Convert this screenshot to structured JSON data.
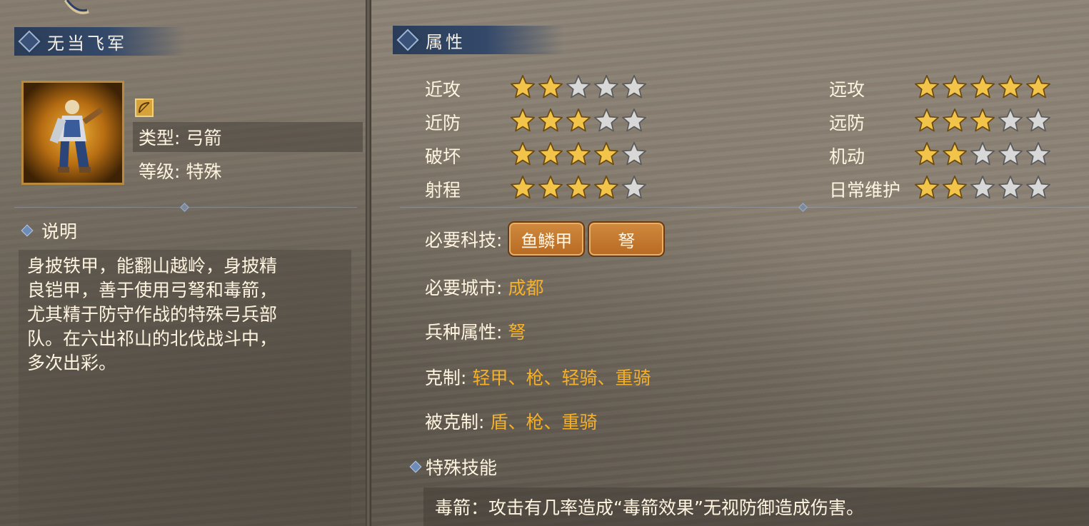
{
  "unit": {
    "name": "无当飞军",
    "type_text": "类型: 弓箭",
    "level_text": "等级: 特殊"
  },
  "description": {
    "header": "说明",
    "lines": [
      "身披铁甲，能翻山越岭，身披精",
      "良铠甲，善于使用弓弩和毒箭，",
      "尤其精于防守作战的特殊弓兵部",
      "队。在六出祁山的北伐战斗中，",
      "多次出彩。"
    ]
  },
  "attributes": {
    "header": "属性",
    "left": [
      {
        "label": "近攻",
        "stars": 2
      },
      {
        "label": "近防",
        "stars": 3
      },
      {
        "label": "破坏",
        "stars": 4
      },
      {
        "label": "射程",
        "stars": 4
      }
    ],
    "right": [
      {
        "label": "远攻",
        "stars": 5
      },
      {
        "label": "远防",
        "stars": 3
      },
      {
        "label": "机动",
        "stars": 2
      },
      {
        "label": "日常维护",
        "stars": 2
      }
    ],
    "max_stars": 5
  },
  "requirements": {
    "tech_label": "必要科技:",
    "tech_items": [
      "鱼鳞甲",
      "弩"
    ],
    "city_label": "必要城市:",
    "city_value": "成都",
    "troop_attr_label": "兵种属性:",
    "troop_attr_value": "弩",
    "counters_label": "克制:",
    "counters_value": "轻甲、枪、轻骑、重骑",
    "countered_by_label": "被克制:",
    "countered_by_value": "盾、枪、重骑"
  },
  "special_skill": {
    "header": "特殊技能",
    "text": "毒箭：攻击有几率造成“毒箭效果”无视防御造成伤害。"
  },
  "colors": {
    "star_filled": "#f2c44a",
    "star_empty": "#d8d8d8",
    "highlight_value": "#f5b02a",
    "title_bar": "#2a3c58"
  }
}
